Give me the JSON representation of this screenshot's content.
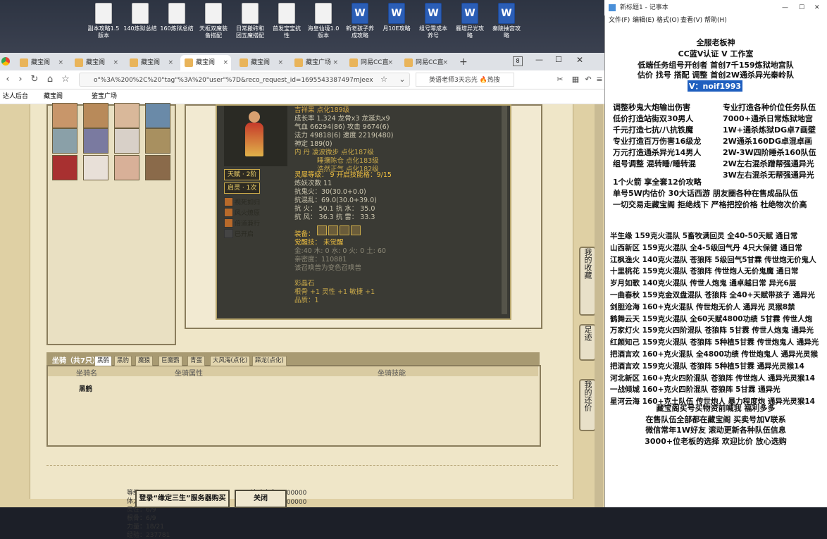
{
  "desktop": {
    "icons": [
      {
        "label": "副本攻略1.5\n版本",
        "type": "doc"
      },
      {
        "label": "140炼狱总结",
        "type": "doc"
      },
      {
        "label": "160炼狱总结",
        "type": "doc"
      },
      {
        "label": "天枢双魔装\n备搭配",
        "type": "doc"
      },
      {
        "label": "日常搬砖和\n团五魔搭配",
        "type": "doc"
      },
      {
        "label": "首发宝宝抗\n性",
        "type": "doc"
      },
      {
        "label": "海皇仙境1.0\n版本",
        "type": "doc"
      },
      {
        "label": "新老孩子养\n成攻略",
        "type": "word"
      },
      {
        "label": "月10E攻略",
        "type": "word"
      },
      {
        "label": "组号零成本\n养号",
        "type": "word"
      },
      {
        "label": "雁塔异光攻\n略",
        "type": "word"
      },
      {
        "label": "秦陵抽宫攻\n略",
        "type": "word"
      }
    ]
  },
  "browser": {
    "tabs": [
      {
        "label": "藏宝阁",
        "active": false
      },
      {
        "label": "藏宝阁",
        "active": false
      },
      {
        "label": "藏宝阁",
        "active": false
      },
      {
        "label": "藏宝阁",
        "active": true
      },
      {
        "label": "藏宝阁",
        "active": false
      },
      {
        "label": "藏宝广场",
        "active": false
      },
      {
        "label": "网易CC直",
        "active": false
      },
      {
        "label": "网易CC直",
        "active": false
      }
    ],
    "tab_count": "8",
    "url": "o\"%3A%200%2C%20\"tag\"%3A%20\"user\"%7D&reco_request_id=1695543387497mJeex",
    "search": "英语老师3天忘光 🔥热搜",
    "bookmarks": [
      "达人后台",
      "藏宝阁",
      "鉴宝广场"
    ]
  },
  "game": {
    "pet": {
      "name_line": "吉祥果 点化189级",
      "growth": "成长率 1.324 龙骨x3 龙涎丸x9",
      "hp": "气血 66294(86) 攻击 9674(6)",
      "mp": "法力 49818(6) 速度 2219(480)",
      "shen": "神定 189(0)",
      "neidan": [
        "内 丹 凌波微步 点化187级",
        "睡攘陈仓 点化183级",
        "浩然正气 点化182级"
      ],
      "lingxi": "灵犀等级： 9 开启技能格：9/15",
      "lianhua": "炼妖次数 11",
      "kanggui": "抗鬼火：30(30.0+0.0)",
      "kanghun": "抗混乱：69.0(30.0+39.0)",
      "kanghuo": "抗 火： 50.1 抗 水： 35.0",
      "kangfeng": "抗 风： 36.3 抗 雷： 33.3",
      "equip_label": "装备：",
      "awaken": "觉醒技： 未觉醒",
      "elements": "金:40 木: 0 水: 0 火: 0 土: 60",
      "qinmi": "亲密度：110881",
      "hint": "该召唤兽为变色召唤兽",
      "caiyu_title": "彩晶石",
      "caiyu": "根骨 +1 灵性 +1 敏捷 +1",
      "pinzhi": "品质：1"
    },
    "tags": [
      {
        "label": "天赋 · 2阶"
      },
      {
        "label": "启灵 · 1次"
      }
    ],
    "cats": [
      "视死如归",
      "风火燎原",
      "倍道兼行",
      "已开启"
    ],
    "side_buttons": [
      "我的收藏",
      "足迹",
      "我的还价"
    ],
    "mounts": {
      "title": "坐骑（共7只）",
      "tabs": [
        "黑鹤",
        "黑豹",
        "魔猿",
        "巨魔鹦",
        "青蛋",
        "大风海(点化)",
        "蹄龙(点化)"
      ],
      "headers": [
        "坐骑名",
        "坐骑属性",
        "坐骑技能"
      ],
      "name": "黑鹤",
      "attrs": [
        "等级：100",
        "体力：1352",
        "灵性：6/9",
        "根骨：6/9",
        "力量：18/21",
        "经验：237781"
      ],
      "skills": [
        "追魂夺命：100000",
        "破釜沉舟：100000"
      ]
    },
    "buttons": [
      "登录“缘定三生”服务器购买",
      "关闭"
    ]
  },
  "notepad": {
    "title": "新标题1 - 记事本",
    "menu": [
      "文件(F)",
      "编辑(E)",
      "格式(O)",
      "查看(V)",
      "帮助(H)"
    ],
    "lines_top": [
      "全服老板神",
      "CC蓝V认证  V  工作室",
      "低端任务组号开创者          首创7千159炼狱地宫队",
      "估价 找号 搭配 调整          首创2W通杀异光秦岭队",
      "V：noif1993"
    ],
    "cols_left": [
      "调整秒鬼大炮输出伤害",
      "低价打造站街双30男人",
      "千元打造七抗/八抗铁魔",
      "专业打造百万伤害16级龙",
      "万元打造通杀异光14男人",
      "组号调整 混转睡/睡转混"
    ],
    "cols_right": [
      "专业打造各种价位任务队伍",
      "7000+通杀日常炼狱地宫",
      "1W+通杀炼狱DG卓7画壁",
      "2W通杀160DG卓混卓画",
      "2W-3W四阶睡杀160队伍",
      "2W左右混杀蹭帮强通异光",
      "3W左右混杀无帮强通异光"
    ],
    "mid": [
      "1个火箭 享全套12价攻略",
      "单号5W内估价 30大话西游          朋友圈各种在售成品队伍",
      "一切交易走藏宝阁 拒绝线下    严格把控价格 杜绝物次价高"
    ],
    "list": [
      "半生缘    159克火混队 5畜牧满回灵 全40-50天赋 通日常",
      "山西新区 159克火混队 全4-5级回气丹 4只大保健 通日常",
      "江枫渔火 140克火混队 苍狼阵 5级回气5甘霖 传世炮无价鬼人",
      "十里桃花 159克火混队 苍狼阵 传世炮人无价鬼魔 通日常",
      "岁月如歌 140克火混队 传世人炮鬼 通卓越日常 异光6层",
      "一曲春秋 159克金双盘混队 苍狼阵 全40+天赋带孩子 通异光",
      "剑胆沧海 160+克火混队 传世炮无价人 通异光 灵猴8禁",
      "鹤舞云天 159克火混队 全60天赋4800功绩 5甘霖 传世人炮",
      "万家灯火  159克火四阶混队 苍狼阵 5甘霖 传世人炮鬼 通异光",
      "红颜知己 159克火混队 苍狼阵 5种植5甘霖 传世炮鬼人 通异光",
      "把酒言欢 160+克火混队 全4800功绩 传世炮鬼人 通异光灵猴",
      "把酒言欢 159克火混队 苍狼阵 5种植5甘霖 通异光灵猴14",
      "河北新区 160+克火四阶混队 苍狼阵 传世炮人 通异光灵猴14",
      "一战倾城 160+克火四阶混队 苍狼阵 5甘霖 通异光",
      "星河云海 160+克土队伍 传世炮人 暴力程度炮 通异光灵猴14"
    ],
    "footer": [
      "藏宝阁买号买物资前喊我 福利多多",
      "在售队伍全部都在藏宝阁 买卖号加V联系",
      "微信常年1W好友 滚动更新各种队伍信息",
      "3000+位老板的选择 欢迎比价 放心选购"
    ]
  }
}
